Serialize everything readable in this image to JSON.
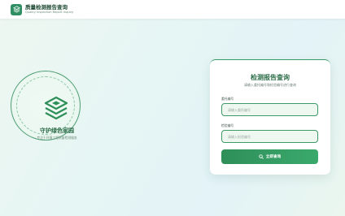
{
  "header": {
    "logo_icon": "shield-icon",
    "title": "质量检测报告查询",
    "subtitle": "Quality Inspection Report Inquiry"
  },
  "hero": {
    "emblem_icon": "layered-shield-icon",
    "title": "守护绿色家园",
    "subtitle": "专注于环境工程质量检测服务"
  },
  "form": {
    "title": "检测报告查询",
    "subtitle": "请输入委托编号和检验编号进行查询",
    "commission": {
      "label": "委托编号",
      "placeholder": "请输入委托编号",
      "value": ""
    },
    "inspection": {
      "label": "检验编号",
      "placeholder": "请输入检验编号",
      "value": ""
    },
    "submit": {
      "icon": "search-icon",
      "label": "立即查询"
    }
  },
  "colors": {
    "primary": "#2f8f59",
    "primary_dark": "#2e6f4b",
    "field_bg": "#eef7f0"
  }
}
